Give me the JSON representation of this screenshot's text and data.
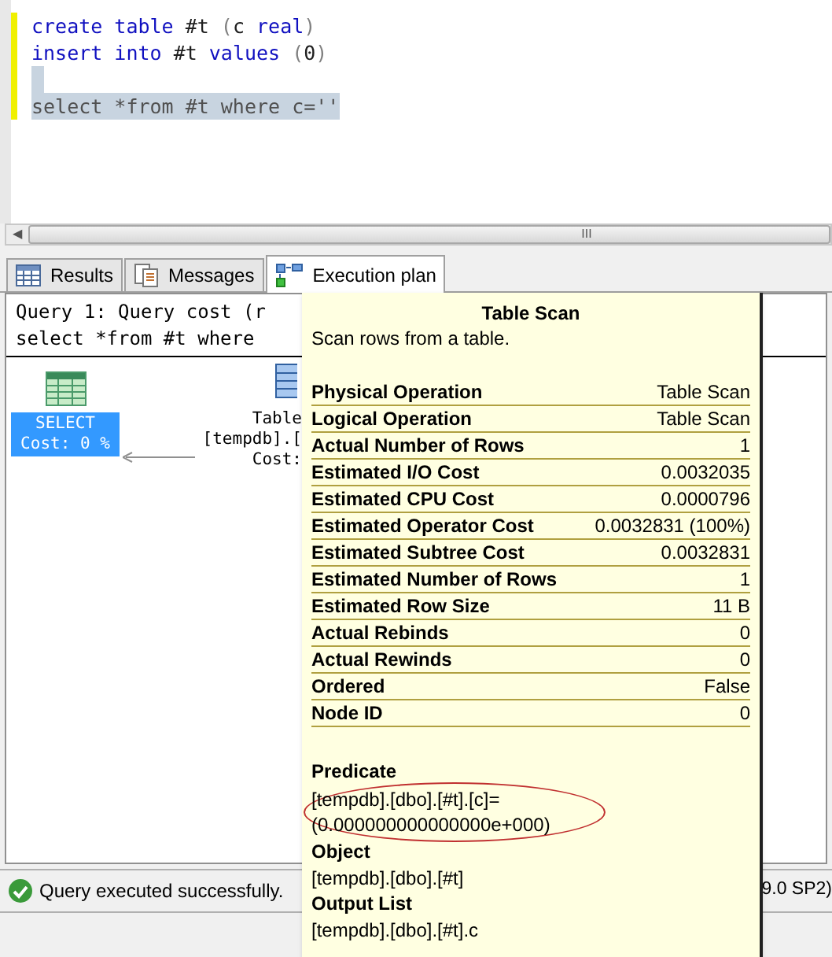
{
  "editor": {
    "lines": [
      {
        "selected": false,
        "tokens": [
          {
            "text": "create",
            "kind": "keyword"
          },
          {
            "text": " table",
            "kind": "keyword"
          },
          {
            "text": " #t ",
            "kind": "plain"
          },
          {
            "text": "(",
            "kind": "punct"
          },
          {
            "text": "c ",
            "kind": "plain"
          },
          {
            "text": "real",
            "kind": "keyword"
          },
          {
            "text": ")",
            "kind": "punct"
          }
        ]
      },
      {
        "selected": false,
        "tokens": [
          {
            "text": "insert",
            "kind": "keyword"
          },
          {
            "text": " into",
            "kind": "keyword"
          },
          {
            "text": " #t ",
            "kind": "plain"
          },
          {
            "text": "values ",
            "kind": "keyword"
          },
          {
            "text": "(",
            "kind": "punct"
          },
          {
            "text": "0",
            "kind": "plain"
          },
          {
            "text": ")",
            "kind": "punct"
          }
        ]
      },
      {
        "selected": true
      },
      {
        "selected": true,
        "tokens": [
          {
            "text": "select *from #t where c=''",
            "kind": "plain"
          }
        ]
      }
    ],
    "scroll_grip": "III",
    "scroll_left": "◀"
  },
  "tabs": [
    {
      "label": "Results",
      "selected": false
    },
    {
      "label": "Messages",
      "selected": false
    },
    {
      "label": "Execution plan",
      "selected": true
    }
  ],
  "plan": {
    "header": [
      "Query 1: Query cost (r",
      "select *from #t where"
    ],
    "select_node": {
      "lines": [
        "SELECT",
        "Cost: 0 %"
      ],
      "selected": true
    },
    "scan_node": {
      "lines": [
        "Table",
        "[tempdb].[",
        "Cost:"
      ]
    }
  },
  "tooltip": {
    "title": "Table Scan",
    "description": "Scan rows from a table.",
    "rows": [
      {
        "label": "Physical Operation",
        "value": "Table Scan"
      },
      {
        "label": "Logical Operation",
        "value": "Table Scan"
      },
      {
        "label": "Actual Number of Rows",
        "value": "1"
      },
      {
        "label": "Estimated I/O Cost",
        "value": "0.0032035"
      },
      {
        "label": "Estimated CPU Cost",
        "value": "0.0000796"
      },
      {
        "label": "Estimated Operator Cost",
        "value": "0.0032831 (100%)"
      },
      {
        "label": "Estimated Subtree Cost",
        "value": "0.0032831"
      },
      {
        "label": "Estimated Number of Rows",
        "value": "1"
      },
      {
        "label": "Estimated Row Size",
        "value": "11 B"
      },
      {
        "label": "Actual Rebinds",
        "value": "0"
      },
      {
        "label": "Actual Rewinds",
        "value": "0"
      },
      {
        "label": "Ordered",
        "value": "False"
      },
      {
        "label": "Node ID",
        "value": "0"
      }
    ],
    "sections": [
      {
        "heading": "Predicate",
        "lines": [
          "[tempdb].[dbo].[#t].[c]=",
          "(0.000000000000000e+000)"
        ],
        "circled": true
      },
      {
        "heading": "Object",
        "lines": [
          "[tempdb].[dbo].[#t]"
        ],
        "circled": false
      },
      {
        "heading": "Output List",
        "lines": [
          "[tempdb].[dbo].[#t].c"
        ],
        "circled": false
      }
    ]
  },
  "status_bar": {
    "message": "Query executed successfully.",
    "version": "9.0 SP2)"
  }
}
